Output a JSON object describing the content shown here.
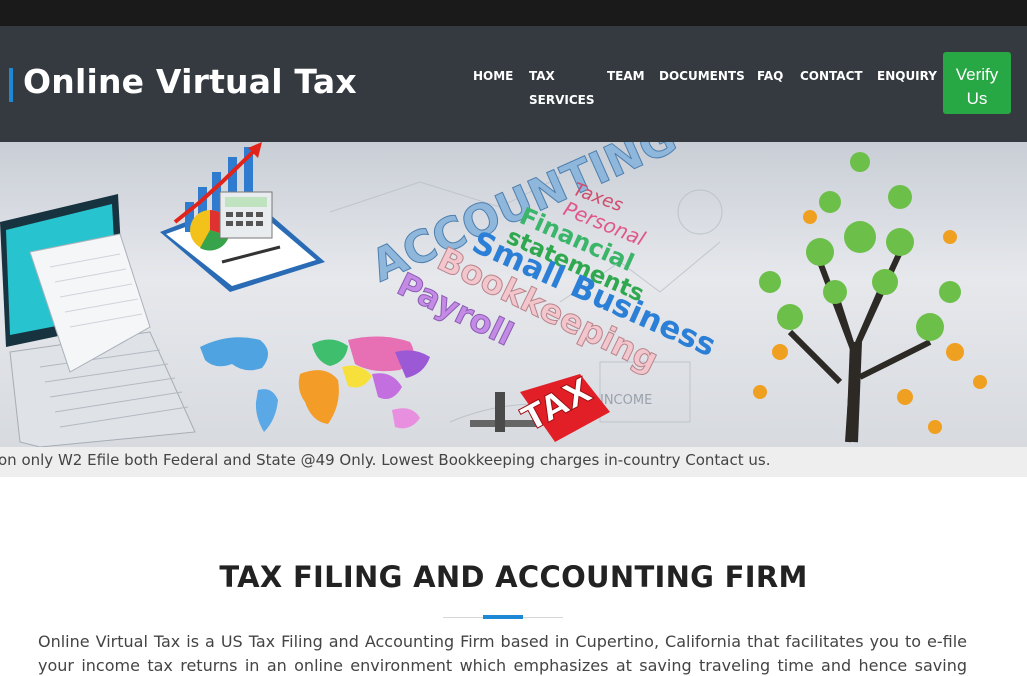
{
  "header": {
    "brand": "Online Virtual Tax",
    "nav": {
      "home": "HOME",
      "tax_services": "TAX SERVICES",
      "team": "TEAM",
      "documents": "DOCUMENTS",
      "faq": "FAQ",
      "contact": "CONTACT",
      "enquiry": "ENQUIRY"
    },
    "verify_button": "Verify Us"
  },
  "hero": {
    "words": {
      "accounting": "ACCOUNTING",
      "taxes": "Taxes",
      "personal": "Personal",
      "financial": "Financial",
      "statements": "statements",
      "small_business": "Small Business",
      "bookkeeping": "Bookkeeping",
      "payroll": "Payroll",
      "tax": "TAX",
      "income": "INCOME"
    }
  },
  "ticker": {
    "text": "on only W2 Efile both Federal and State @49 Only. Lowest Bookkeeping charges in-country Contact us."
  },
  "main": {
    "title": "TAX FILING AND ACCOUNTING FIRM",
    "intro": "Online Virtual Tax is a US Tax Filing and Accounting Firm based in Cupertino, California that facilitates you to e-file your income tax returns in an online environment which emphasizes at saving traveling time and hence saving money and"
  },
  "colors": {
    "header_bg": "#343a40",
    "accent_blue": "#1e88d4",
    "verify_green": "#28a745"
  }
}
